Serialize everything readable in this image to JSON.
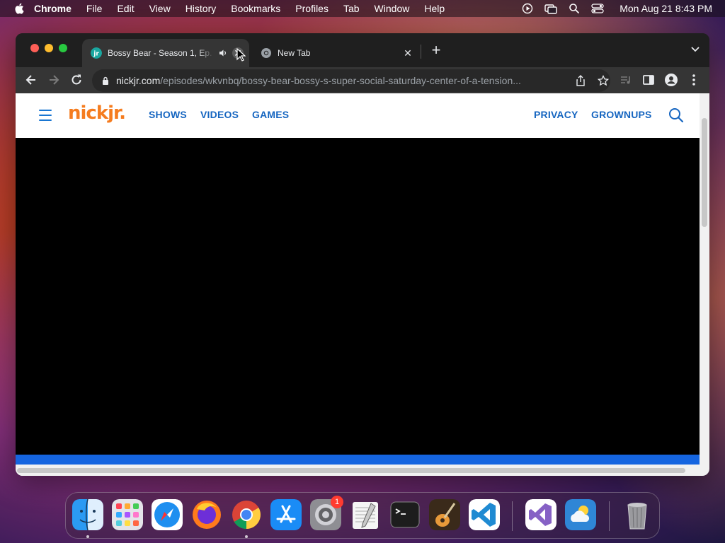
{
  "menubar": {
    "app_name": "Chrome",
    "items": [
      "File",
      "Edit",
      "View",
      "History",
      "Bookmarks",
      "Profiles",
      "Tab",
      "Window",
      "Help"
    ],
    "clock": "Mon Aug 21  8:43 PM"
  },
  "browser": {
    "tabs": [
      {
        "title": "Bossy Bear - Season 1, Ep.",
        "active": true,
        "audio": true
      },
      {
        "title": "New Tab",
        "active": false
      }
    ],
    "new_tab_label": "+",
    "url_host": "nickjr.com",
    "url_path": "/episodes/wkvnbq/bossy-bear-bossy-s-super-social-saturday-center-of-a-tension..."
  },
  "site": {
    "logo_text": "nick",
    "logo_text_suffix": "jr.",
    "nav_left": [
      "SHOWS",
      "VIDEOS",
      "GAMES"
    ],
    "nav_right": [
      "PRIVACY",
      "GROWNUPS"
    ],
    "brand_color": "#f57c1f",
    "link_color": "#1565c0",
    "video_progress_color": "#1565e0"
  },
  "dock": {
    "apps": [
      "Finder",
      "Launchpad",
      "Safari",
      "Firefox",
      "Google Chrome",
      "App Store",
      "System Settings",
      "TextEdit",
      "Terminal",
      "GarageBand",
      "Visual Studio Code",
      "Visual Studio",
      "Weather",
      "Trash"
    ],
    "system_settings_badge": "1"
  }
}
